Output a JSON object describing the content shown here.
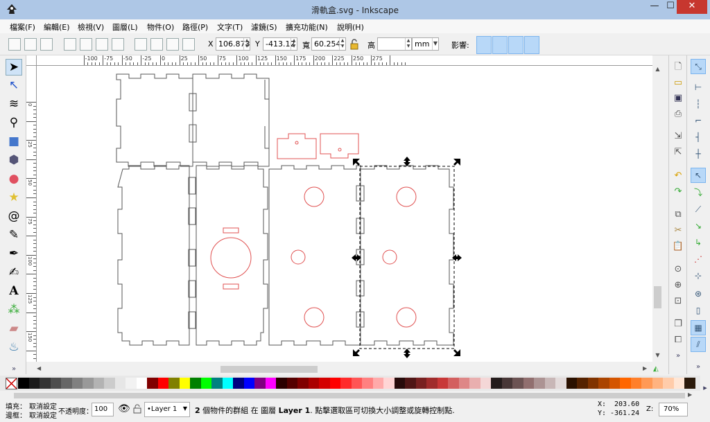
{
  "window": {
    "title": "滑軌盒.svg - Inkscape",
    "minimize": "—",
    "maximize": "☐",
    "close": "✕"
  },
  "menu": [
    "檔案(F)",
    "編輯(E)",
    "檢視(V)",
    "圖層(L)",
    "物件(O)",
    "路徑(P)",
    "文字(T)",
    "濾鏡(S)",
    "擴充功能(N)",
    "說明(H)"
  ],
  "toolbar": {
    "x_label": "X",
    "x_value": "106.873",
    "y_label": "Y",
    "y_value": "-413.12",
    "w_label": "寬",
    "w_value": "60.254",
    "h_label": "高",
    "h_value": "",
    "unit": "mm",
    "affect_label": "影響:",
    "lock_icon": "lock-icon"
  },
  "ruler": {
    "labels": [
      "-100",
      "-75",
      "-50",
      "-25",
      "0",
      "25",
      "50",
      "75",
      "100",
      "125",
      "150",
      "175",
      "200",
      "225",
      "250",
      "275"
    ],
    "vlabels": [
      "0",
      "25",
      "50",
      "75",
      "100",
      "125",
      "150",
      "175"
    ]
  },
  "tools": [
    "selector-tool",
    "node-tool",
    "tweak-tool",
    "zoom-tool",
    "rect-tool",
    "3dbox-tool",
    "ellipse-tool",
    "star-tool",
    "spiral-tool",
    "pencil-tool",
    "pen-tool",
    "calligraphy-tool",
    "text-tool",
    "spray-tool",
    "eraser-tool",
    "bucket-tool"
  ],
  "colors": {
    "outline": "#555555",
    "red_outline": "#e05050",
    "selection": "#000000",
    "accent": "#b8d8f8"
  },
  "palette": [
    "#000000",
    "#1a1a1a",
    "#333333",
    "#4d4d4d",
    "#666666",
    "#808080",
    "#999999",
    "#b3b3b3",
    "#cccccc",
    "#e6e6e6",
    "#f2f2f2",
    "#ffffff",
    "#800000",
    "#ff0000",
    "#808000",
    "#ffff00",
    "#008000",
    "#00ff00",
    "#008080",
    "#00ffff",
    "#000080",
    "#0000ff",
    "#800080",
    "#ff00ff",
    "#2b0000",
    "#550000",
    "#800000",
    "#aa0000",
    "#d40000",
    "#ff0000",
    "#ff2a2a",
    "#ff5555",
    "#ff8080",
    "#ffaaaa",
    "#ffd5d5",
    "#280b0b",
    "#501616",
    "#782121",
    "#a02c2c",
    "#c83737",
    "#d35f5f",
    "#de8787",
    "#e9afaf",
    "#f4d7d7",
    "#241c1c",
    "#483737",
    "#6c5353",
    "#916f6f",
    "#ac9393",
    "#c8b7b7",
    "#e3dbdb",
    "#2b1100",
    "#552200",
    "#803300",
    "#aa4400",
    "#d45500",
    "#ff6600",
    "#ff7f2a",
    "#ff9955",
    "#ffb380",
    "#ffccaa",
    "#ffe6d5",
    "#2b1a0b"
  ],
  "status": {
    "fill_label": "填充：",
    "fill_value": "取消設定",
    "stroke_label": "邊框：",
    "stroke_value": "取消設定",
    "opacity_label": "不透明度：",
    "opacity_value": "100",
    "layer": "•Layer 1",
    "message_bold_a": "2",
    "message_1": " 個物件的群組 在 圖層 ",
    "message_bold_b": "Layer 1",
    "message_2": ". 點擊選取區可切換大小調整或旋轉控制點.",
    "x_label": "X:",
    "x_value": "203.60",
    "y_label": "Y:",
    "y_value": "-361.24",
    "zoom_label": "Z:",
    "zoom_value": "70%"
  }
}
